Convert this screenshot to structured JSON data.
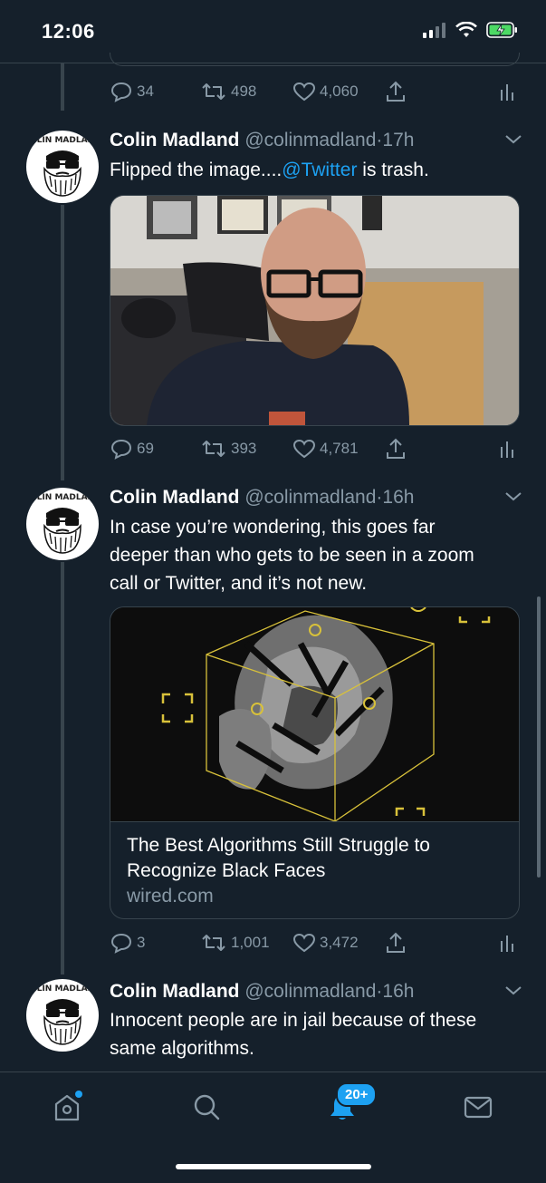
{
  "status_bar": {
    "time": "12:06"
  },
  "prev_tweet": {
    "replies": "34",
    "retweets": "498",
    "likes": "4,060"
  },
  "tweets": [
    {
      "name": "Colin Madland",
      "handle": "@colinmadland",
      "age": "17h",
      "text_before": "Flipped the image....",
      "mention": "@Twitter",
      "text_after": " is trash.",
      "replies": "69",
      "retweets": "393",
      "likes": "4,781"
    },
    {
      "name": "Colin Madland",
      "handle": "@colinmadland",
      "age": "16h",
      "text": "In case you’re wondering, this goes far deeper than who gets to be seen in a zoom call or Twitter, and it’s not new.",
      "card": {
        "title": "The Best Algorithms Still Struggle to Recognize Black Faces",
        "domain": "wired.com"
      },
      "replies": "3",
      "retweets": "1,001",
      "likes": "3,472"
    },
    {
      "name": "Colin Madland",
      "handle": "@colinmadland",
      "age": "16h",
      "text": "Innocent people are in jail because of these same algorithms."
    }
  ],
  "avatar_text": "COLIN MADLAND",
  "separator": "·",
  "tabbar": {
    "notifications_badge": "20+"
  },
  "colors": {
    "background": "#15202b",
    "accent": "#1da1f2",
    "muted": "#8899a6",
    "border": "#38444d"
  },
  "icons": [
    "home-icon",
    "search-icon",
    "bell-icon",
    "mail-icon",
    "reply-icon",
    "retweet-icon",
    "like-icon",
    "share-icon",
    "analytics-icon",
    "chevron-down-icon"
  ]
}
